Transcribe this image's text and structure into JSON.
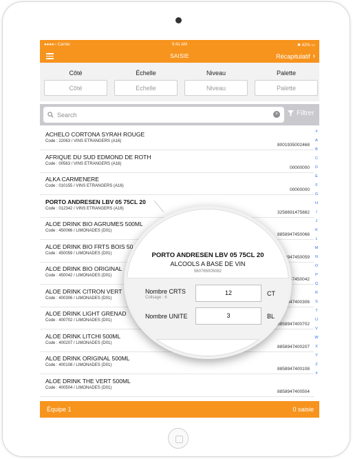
{
  "status": {
    "carrier": "Carrier",
    "time": "9:41 AM",
    "battery": "42%"
  },
  "nav": {
    "title": "SAISIE",
    "right_label": "Récapitulatif"
  },
  "filters": [
    {
      "label": "Côté",
      "placeholder": "Côté"
    },
    {
      "label": "Échelle",
      "placeholder": "Echelle"
    },
    {
      "label": "Niveau",
      "placeholder": "Niveau"
    },
    {
      "label": "Palette",
      "placeholder": "Palette"
    }
  ],
  "search": {
    "placeholder": "Search",
    "filter_label": "Filtrer"
  },
  "products": [
    {
      "name": "ACHELO CORTONA SYRAH ROUGE",
      "code": "Code : 22063 / VINS ETRANGERS (A16)",
      "ean": "8001935002468"
    },
    {
      "name": "AFRIQUE DU SUD EDMOND DE ROTH",
      "code": "Code : 00563 / VINS ETRANGERS (A16)",
      "ean": "00000000"
    },
    {
      "name": "ALKA CARMENERE",
      "code": "Code : 010155 / VINS ETRANGERS (A16)",
      "ean": "00000000"
    },
    {
      "name": "PORTO ANDRESEN LBV 05 75CL 20",
      "code": "Code : 012342 / VINS ETRANGERS (A16)",
      "ean": "3258691475882"
    },
    {
      "name": "ALOE DRINK BIO AGRUMES 500ML",
      "code": "Code : 450066 / LIMONADES (D01)",
      "ean": "8858947450066"
    },
    {
      "name": "ALOE DRINK BIO FRTS BOIS 50",
      "code": "Code : 450059 / LIMONADES (D01)",
      "ean": "8858947450059"
    },
    {
      "name": "ALOE DRINK BIO ORIGINAL",
      "code": "Code : 450042 / LIMONADES (D01)",
      "ean": "8858947450042"
    },
    {
      "name": "ALOE DRINK CITRON VERT",
      "code": "Code : 400306 / LIMONADES (D01)",
      "ean": "8858947400306"
    },
    {
      "name": "ALOE DRINK LIGHT GRENAD",
      "code": "Code : 400702 / LIMONADES (D01)",
      "ean": "8858947400702"
    },
    {
      "name": "ALOE DRINK LITCHI 500ML",
      "code": "Code : 400207 / LIMONADES (D01)",
      "ean": "8858947400207"
    },
    {
      "name": "ALOE DRINK ORIGINAL 500ML",
      "code": "Code : 400108 / LIMONADES (D01)",
      "ean": "8858947400108"
    },
    {
      "name": "ALOE DRINK THE VERT 500ML",
      "code": "Code : 400504 / LIMONADES (D01)",
      "ean": "8858947400504"
    }
  ],
  "index_letters": [
    "#",
    "A",
    "B",
    "C",
    "D",
    "E",
    "F",
    "G",
    "H",
    "I",
    "J",
    "K",
    "L",
    "M",
    "N",
    "O",
    "P",
    "Q",
    "R",
    "S",
    "T",
    "U",
    "V",
    "W",
    "X",
    "Y",
    "Z",
    "#"
  ],
  "detail": {
    "title": "PORTO ANDRESEN LBV 05 75CL 20",
    "category": "ALCOOLS A BASE DE VIN",
    "ean": "560765005082",
    "crts_label": "Nombre CRTS",
    "colisage": "Colisage : 6",
    "crts_value": "12",
    "crts_unit": "CT",
    "unite_label": "Nombre UNITE",
    "unite_value": "3",
    "unite_unit": "BL"
  },
  "footer": {
    "team": "Équipe 1",
    "count": "0 saisie"
  },
  "colors": {
    "accent": "#f7941d",
    "index": "#2a6df4"
  }
}
